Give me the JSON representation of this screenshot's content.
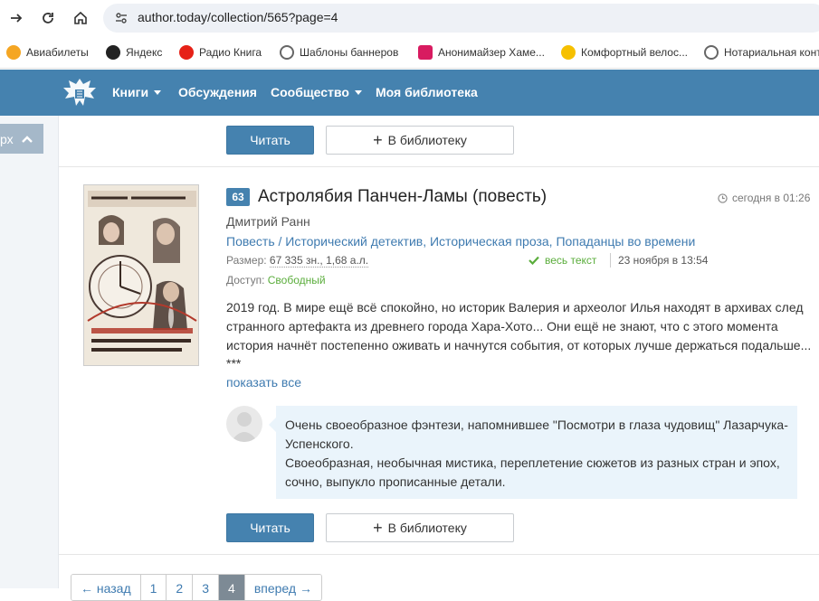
{
  "browser": {
    "url": "author.today/collection/565?page=4",
    "bookmarks": [
      {
        "label": "Авиабилеты",
        "icon": "plane-icon",
        "color": "#f5a623"
      },
      {
        "label": "Яндекс",
        "icon": "yandex-icon",
        "color": "#222222"
      },
      {
        "label": "Радио Книга",
        "icon": "youtube-icon",
        "color": "#e62117"
      },
      {
        "label": "Шаблоны баннеров",
        "icon": "globe-icon",
        "color": "#666666"
      },
      {
        "label": "Анонимайзер Хаме...",
        "icon": "anonymizer-icon",
        "color": "#d81b60"
      },
      {
        "label": "Комфортный велос...",
        "icon": "bike-icon",
        "color": "#f6c000"
      },
      {
        "label": "Нотариальная конт",
        "icon": "globe-icon",
        "color": "#666666"
      }
    ]
  },
  "header": {
    "nav": [
      {
        "label": "Книги",
        "dropdown": true
      },
      {
        "label": "Обсуждения",
        "dropdown": false
      },
      {
        "label": "Сообщество",
        "dropdown": true
      },
      {
        "label": "Моя библиотека",
        "dropdown": false
      }
    ],
    "accent": "#4582af"
  },
  "up_button": {
    "label": "рх"
  },
  "actions": {
    "read": "Читать",
    "library": "В библиотеку"
  },
  "book": {
    "number": "63",
    "title": "Астролябия Панчен-Ламы (повесть)",
    "time": "сегодня в 01:26",
    "author": "Дмитрий Ранн",
    "genres": "Повесть / Исторический детектив, Историческая проза, Попаданцы во времени",
    "size_label": "Размер:",
    "size_value": "67 335 зн., 1,68 а.л.",
    "full_text": "весь текст",
    "date": "23 ноября в 13:54",
    "access_label": "Доступ:",
    "access_value": "Свободный",
    "annotation": "2019 год. В мире ещё всё спокойно, но историк Валерия и археолог Илья находят в архивах след странного артефакта из древнего города Хара-Хото... Они ещё не знают, что с этого момента история начнёт постепенно оживать и начнутся события, от которых лучше держаться подальше...",
    "annotation_more": "***",
    "show_all": "показать все",
    "review_line1": "Очень своеобразное фэнтези, напомнившее \"Посмотри в глаза чудовищ\" Лазарчука-Успенского.",
    "review_line2": "Своеобразная, необычная мистика, переплетение сюжетов из разных стран и эпох, сочно, выпукло прописанные детали."
  },
  "pagination": {
    "prev": "← назад",
    "pages": [
      "1",
      "2",
      "3",
      "4"
    ],
    "active": "4",
    "next": "вперед →"
  }
}
